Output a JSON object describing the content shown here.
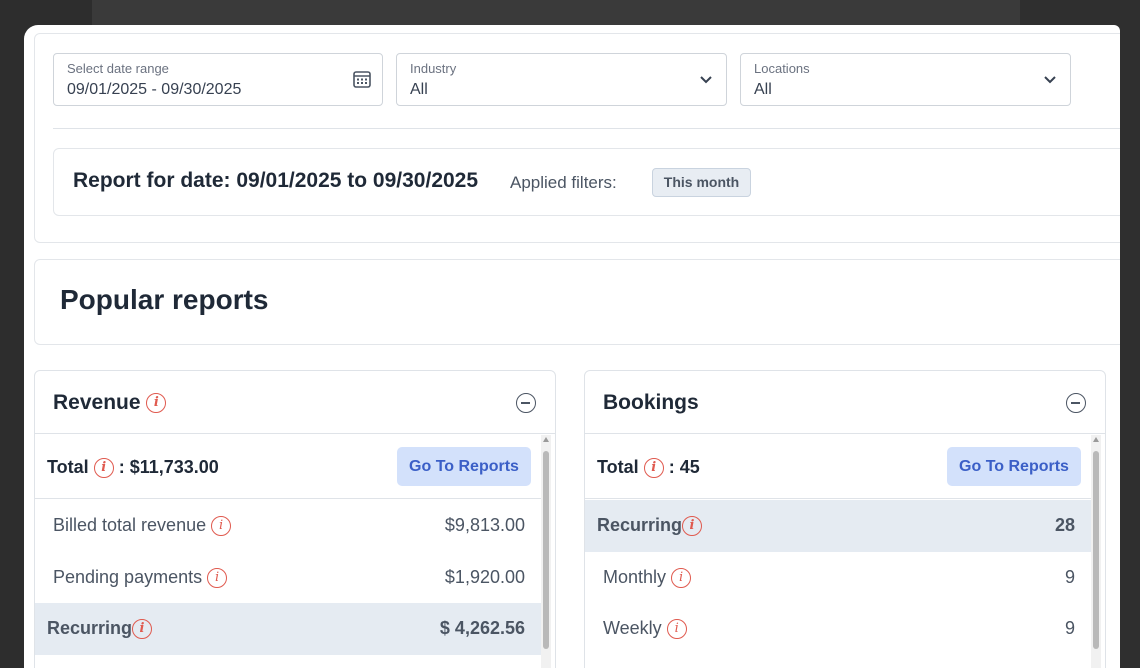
{
  "filters": {
    "date_range": {
      "label": "Select date range",
      "value": "09/01/2025 - 09/30/2025",
      "icon": "calendar-icon"
    },
    "industry": {
      "label": "Industry",
      "value": "All",
      "icon": "chevron-down-icon"
    },
    "locations": {
      "label": "Locations",
      "value": "All",
      "icon": "chevron-down-icon"
    }
  },
  "report": {
    "title": "Report for date: 09/01/2025 to 09/30/2025",
    "applied_label": "Applied filters:",
    "chip": "This month"
  },
  "popular": {
    "title": "Popular reports"
  },
  "revenue": {
    "title": "Revenue",
    "total_label": "Total",
    "total_value": ": $11,733.00",
    "go_to": "Go To Reports",
    "rows": [
      {
        "name": "Billed total revenue",
        "amount": "$9,813.00"
      },
      {
        "name": "Pending payments",
        "amount": "$1,920.00"
      },
      {
        "name": "Recurring",
        "amount": "$ 4,262.56"
      }
    ]
  },
  "bookings": {
    "title": "Bookings",
    "total_label": "Total",
    "total_value": ": 45",
    "go_to": "Go To Reports",
    "rows": [
      {
        "name": "Recurring",
        "amount": "28"
      },
      {
        "name": "Monthly",
        "amount": "9"
      },
      {
        "name": "Weekly",
        "amount": "9"
      }
    ]
  },
  "colors": {
    "accent": "#3b5fc7",
    "button_bg": "#d3e1fb",
    "info": "#e05a4f",
    "highlight_row": "#e5ebf2"
  }
}
